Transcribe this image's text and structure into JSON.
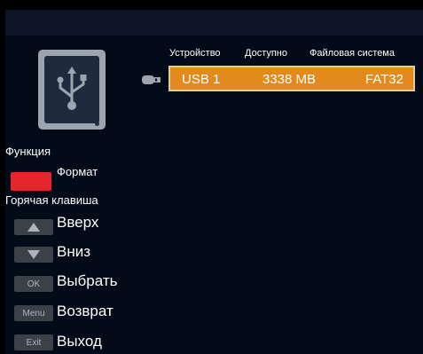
{
  "storage_table": {
    "headers": {
      "device": "Устройство",
      "available": "Доступно",
      "filesystem": "Файловая система"
    },
    "rows": [
      {
        "device": "USB 1",
        "available": "3338 MB",
        "filesystem": "FAT32"
      }
    ]
  },
  "help_panel": {
    "function_title": "Функция",
    "format_label": "Формат",
    "hotkey_title": "Горячая клавиша",
    "hotkeys": [
      {
        "key": "up-arrow-icon",
        "label": "Вверх"
      },
      {
        "key": "down-arrow-icon",
        "label": "Вниз"
      },
      {
        "key": "OK",
        "label": "Выбрать"
      },
      {
        "key": "Menu",
        "label": "Возврат"
      },
      {
        "key": "Exit",
        "label": "Выход"
      }
    ]
  },
  "colors": {
    "background": "#030a18",
    "selection": "#e38a1c",
    "format_key": "#e5252a",
    "key_gray": "#3c4047"
  },
  "icons": {
    "device": "usb-drive-icon",
    "plug": "usb-plug-icon"
  }
}
